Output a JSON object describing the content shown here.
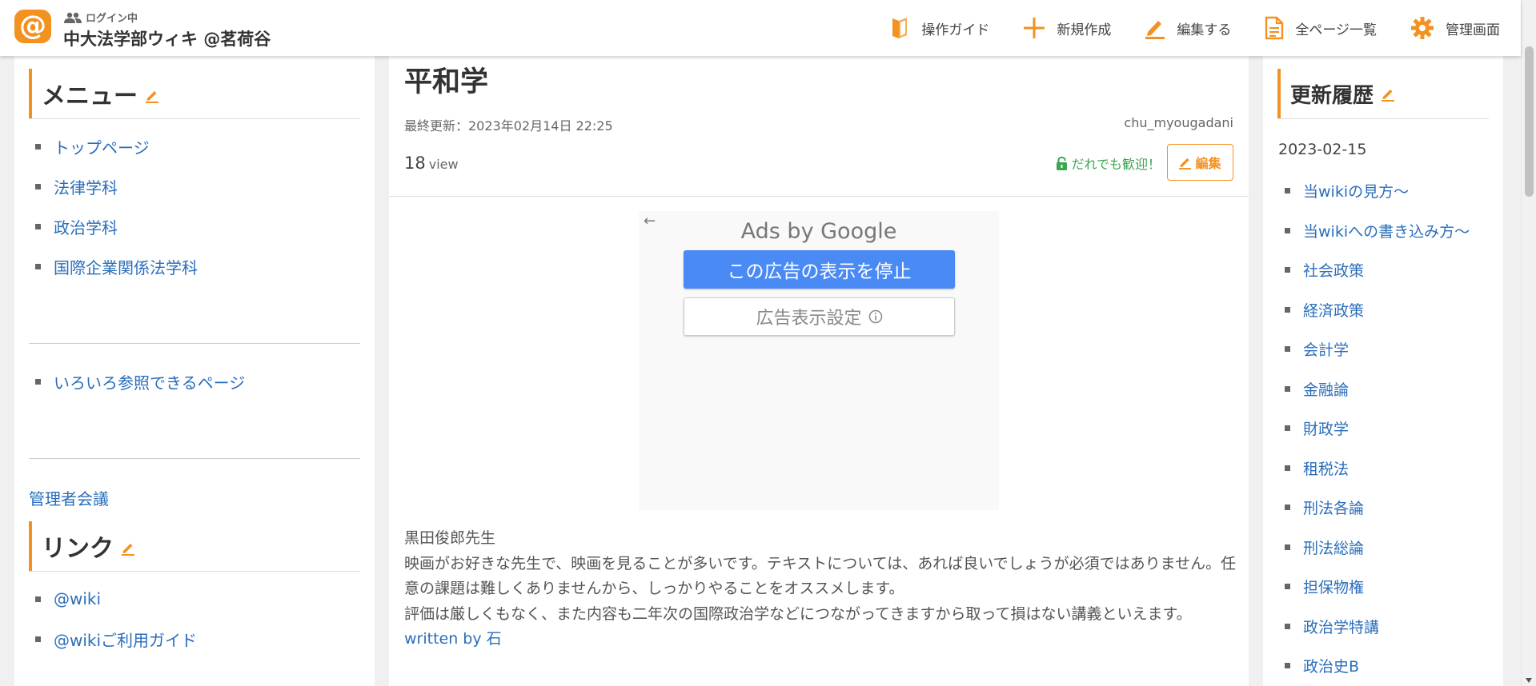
{
  "header": {
    "login_status": "ログイン中",
    "site_title": "中大法学部ウィキ @茗荷谷",
    "nav": [
      {
        "label": "操作ガイド",
        "icon": "guide-book-icon"
      },
      {
        "label": "新規作成",
        "icon": "plus-icon"
      },
      {
        "label": "編集する",
        "icon": "pencil-icon"
      },
      {
        "label": "全ページ一覧",
        "icon": "document-icon"
      },
      {
        "label": "管理画面",
        "icon": "gear-icon"
      }
    ]
  },
  "colors": {
    "accent": "#f39121",
    "link": "#2a6ebb",
    "welcome": "#3aa650",
    "ad_button": "#4a8af4"
  },
  "left_sidebar": {
    "menu_title": "メニュー",
    "menu_items": [
      "トップページ",
      "法律学科",
      "政治学科",
      "国際企業関係法学科"
    ],
    "extra_items": [
      "いろいろ参照できるページ"
    ],
    "admin_link": "管理者会議",
    "links_title": "リンク",
    "link_items": [
      "@wiki",
      "@wikiご利用ガイド"
    ]
  },
  "main": {
    "title": "平和学",
    "last_updated": "最終更新：2023年02月14日 22:25",
    "author": "chu_myougadani",
    "views": "18",
    "views_unit": "view",
    "welcome": "だれでも歓迎！",
    "edit_label": "編集",
    "ad": {
      "back": "←",
      "ads_by": "Ads by Google",
      "stop": "この広告の表示を停止",
      "settings": "広告表示設定"
    },
    "body": {
      "teacher": "黒田俊郎先生",
      "p1": "映画がお好きな先生で、映画を見ることが多いです。テキストについては、あれば良いでしょうが必須ではありません。任意の課題は難しくありませんから、しっかりやることをオススメします。",
      "p2": "評価は厳しくもなく、また内容も二年次の国際政治学などにつながってきますから取って損はない講義といえます。",
      "written": "written by 石"
    }
  },
  "right_sidebar": {
    "title": "更新履歴",
    "date": "2023-02-15",
    "items": [
      "当wikiの見方〜",
      "当wikiへの書き込み方〜",
      "社会政策",
      "経済政策",
      "会計学",
      "金融論",
      "財政学",
      "租税法",
      "刑法各論",
      "刑法総論",
      "担保物権",
      "政治学特講",
      "政治史B"
    ]
  }
}
